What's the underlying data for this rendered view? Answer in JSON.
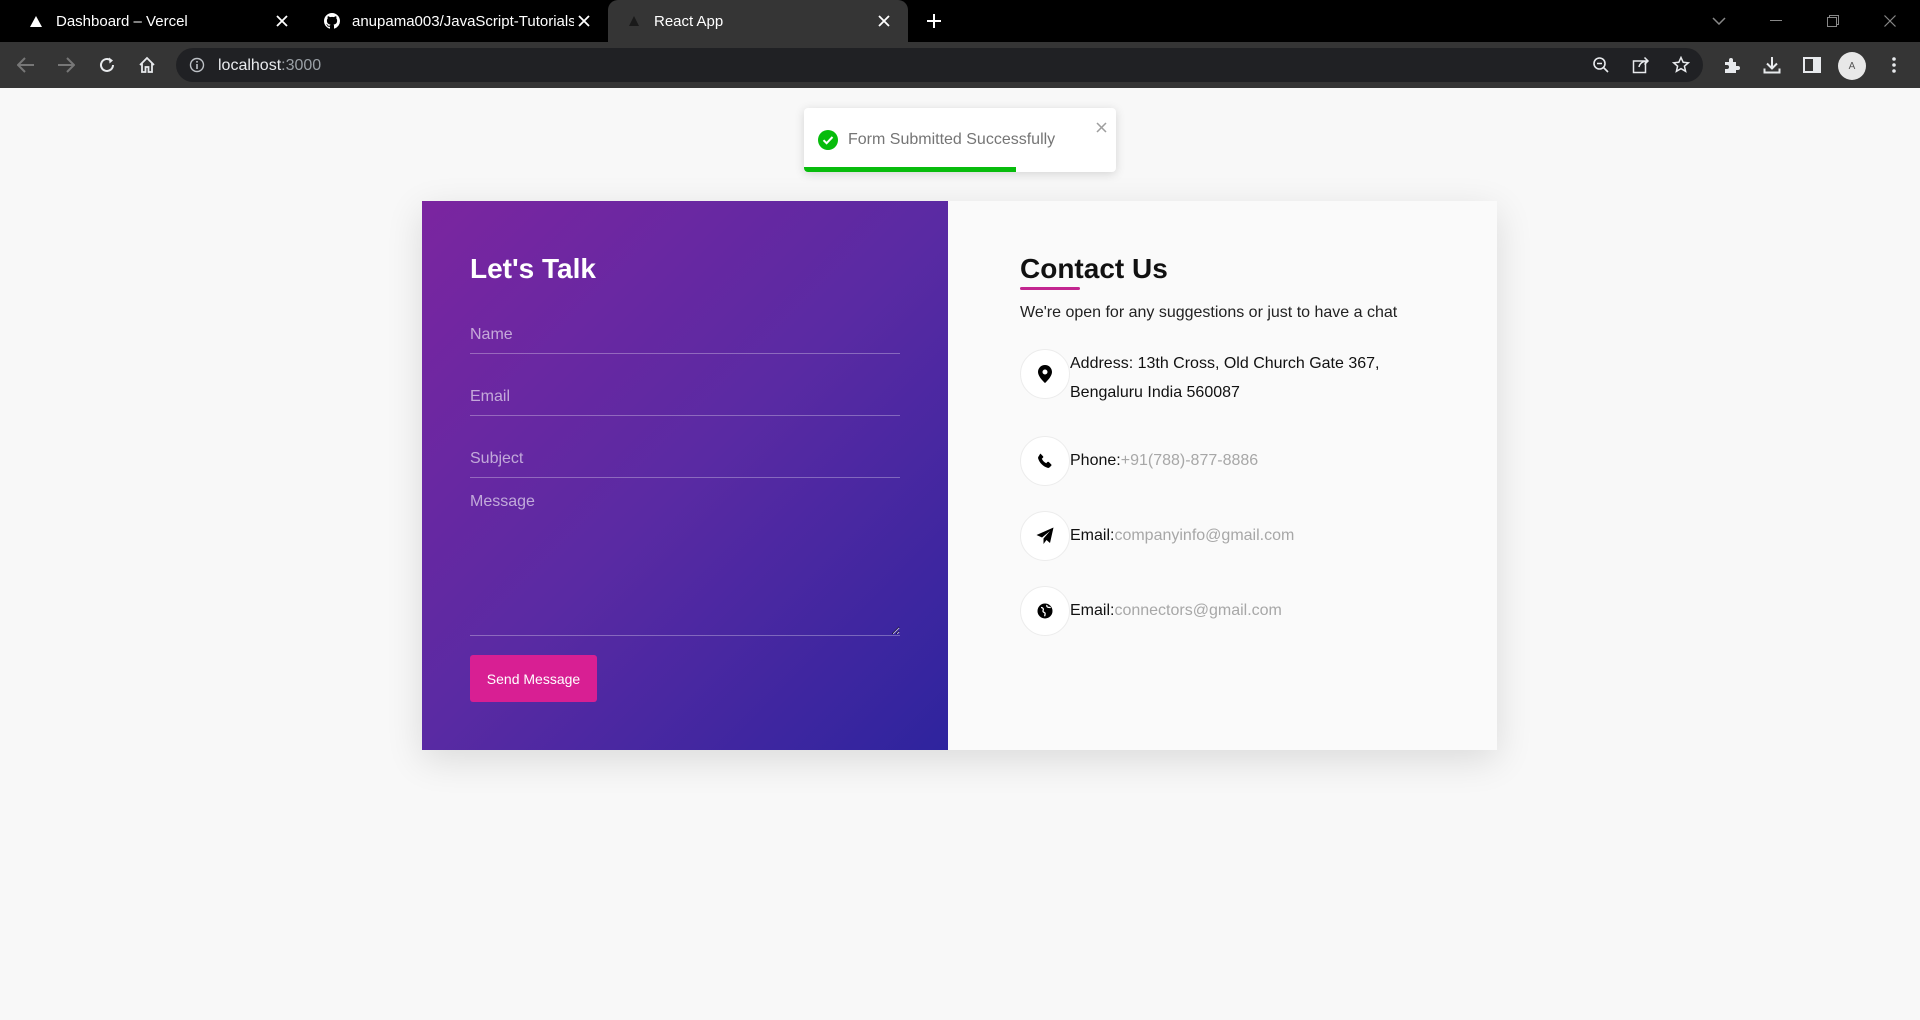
{
  "browser": {
    "tabs": [
      {
        "title": "Dashboard – Vercel",
        "icon": "vercel-icon"
      },
      {
        "title": "anupama003/JavaScript-Tutorials",
        "icon": "github-icon"
      },
      {
        "title": "React App",
        "icon": "react-icon",
        "active": true
      }
    ],
    "url_host": "localhost",
    "url_path": ":3000"
  },
  "toast": {
    "message": "Form Submitted Successfully",
    "progress": 0.68,
    "color": "#07bc0c"
  },
  "form": {
    "title": "Let's Talk",
    "name_placeholder": "Name",
    "email_placeholder": "Email",
    "subject_placeholder": "Subject",
    "message_placeholder": "Message",
    "submit_label": "Send Message",
    "gradient_start": "#7b25a0",
    "gradient_end": "#2e249e",
    "button_color": "#d81f93"
  },
  "contact": {
    "title": "Contact Us",
    "subtitle": "We're open for any suggestions or just to have a chat",
    "accent": "#c2258f",
    "items": [
      {
        "icon": "map-pin-icon",
        "label": "Address:",
        "value": " 13th Cross, Old Church Gate 367, Bengaluru India 560087"
      },
      {
        "icon": "phone-icon",
        "label": "Phone:",
        "value": "+91(788)-877-8886"
      },
      {
        "icon": "paper-plane-icon",
        "label": "Email:",
        "value": "companyinfo@gmail.com"
      },
      {
        "icon": "globe-icon",
        "label": "Email:",
        "value": "connectors@gmail.com"
      }
    ]
  }
}
